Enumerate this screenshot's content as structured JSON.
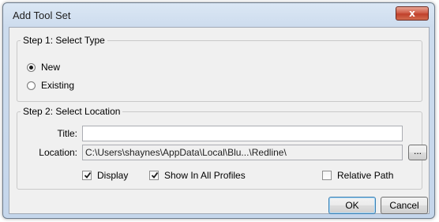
{
  "dialog": {
    "title": "Add Tool Set",
    "close_glyph": "x"
  },
  "step1": {
    "legend": "Step 1: Select Type",
    "options": [
      {
        "label": "New",
        "checked": true
      },
      {
        "label": "Existing",
        "checked": false
      }
    ]
  },
  "step2": {
    "legend": "Step 2: Select Location",
    "title_label": "Title:",
    "title_value": "",
    "location_label": "Location:",
    "location_value": "C:\\Users\\shaynes\\AppData\\Local\\Blu...\\Redline\\",
    "browse_label": "...",
    "display_label": "Display",
    "display_checked": true,
    "show_all_label": "Show In All Profiles",
    "show_all_checked": true,
    "relative_label": "Relative Path",
    "relative_checked": false
  },
  "buttons": {
    "ok": "OK",
    "cancel": "Cancel"
  }
}
